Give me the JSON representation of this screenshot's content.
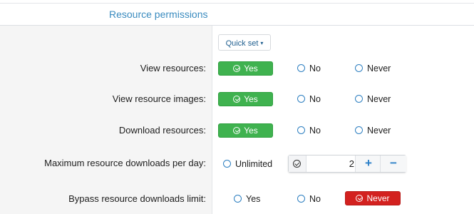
{
  "section": {
    "title": "Resource permissions"
  },
  "quick_set": {
    "label": "Quick set",
    "caret": "▾"
  },
  "rows": [
    {
      "label": "View resources:",
      "yes": "Yes",
      "no": "No",
      "never": "Never",
      "selected": "Yes"
    },
    {
      "label": "View resource images:",
      "yes": "Yes",
      "no": "No",
      "never": "Never",
      "selected": "Yes"
    },
    {
      "label": "Download resources:",
      "yes": "Yes",
      "no": "No",
      "never": "Never",
      "selected": "Yes"
    },
    {
      "label": "Maximum resource downloads per day:",
      "unlimited": "Unlimited",
      "value": "2",
      "plus": "+",
      "minus": "−"
    },
    {
      "label": "Bypass resource downloads limit:",
      "yes": "Yes",
      "no": "No",
      "never": "Never",
      "selected": "Never"
    }
  ],
  "colors": {
    "yes_active": "#3fb24f",
    "never_active": "#d3211f",
    "radio_ring": "#2d7fc0",
    "title": "#3a8bbf"
  },
  "icons": {
    "selected": "check-circle-icon",
    "radio": "radio-icon",
    "increment": "plus-icon",
    "decrement": "minus-icon"
  }
}
